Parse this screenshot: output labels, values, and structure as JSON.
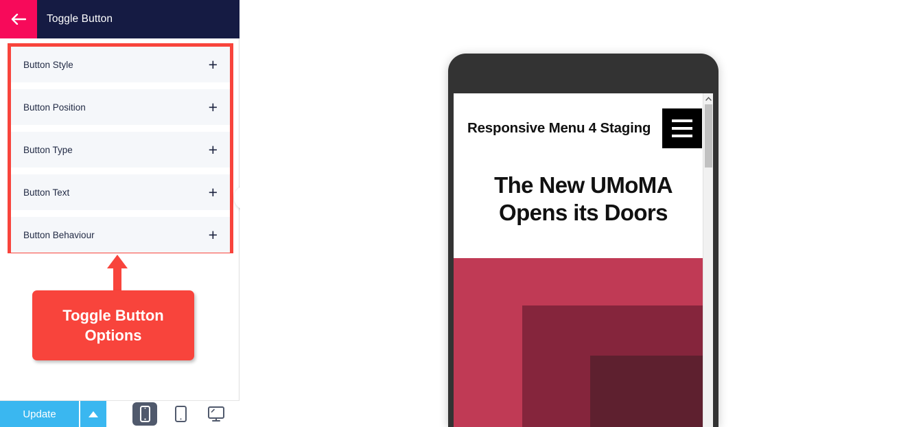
{
  "panel": {
    "title": "Toggle Button",
    "back_icon": "back-arrow-icon",
    "accordion": [
      {
        "label": "Button Style",
        "expand_icon": "plus-icon"
      },
      {
        "label": "Button Position",
        "expand_icon": "plus-icon"
      },
      {
        "label": "Button Type",
        "expand_icon": "plus-icon"
      },
      {
        "label": "Button Text",
        "expand_icon": "plus-icon"
      },
      {
        "label": "Button Behaviour",
        "expand_icon": "plus-icon"
      }
    ],
    "highlight_color": "#f8443c"
  },
  "callout": {
    "line1": "Toggle Button",
    "line2": "Options",
    "color": "#f8443c",
    "arrow_icon": "up-arrow-icon"
  },
  "collapse": {
    "icon": "chevron-left-icon",
    "color": "#3ab7f0"
  },
  "bottom_bar": {
    "update_label": "Update",
    "caret_icon": "caret-up-icon",
    "devices": [
      {
        "name": "mobile",
        "icon": "mobile-icon",
        "active": true
      },
      {
        "name": "tablet",
        "icon": "tablet-icon",
        "active": false
      },
      {
        "name": "desktop",
        "icon": "desktop-icon",
        "active": false
      }
    ],
    "button_color": "#3ab7f0"
  },
  "preview": {
    "site_title": "Responsive Menu 4 Staging",
    "menu_icon": "hamburger-icon",
    "heading_line1": "The New UMoMA",
    "heading_line2": "Opens its Doors",
    "hero_colors": [
      "#c03a55",
      "#85253c",
      "#5e202f"
    ],
    "scrollbar": {
      "up_icon": "chevron-up-icon"
    }
  }
}
